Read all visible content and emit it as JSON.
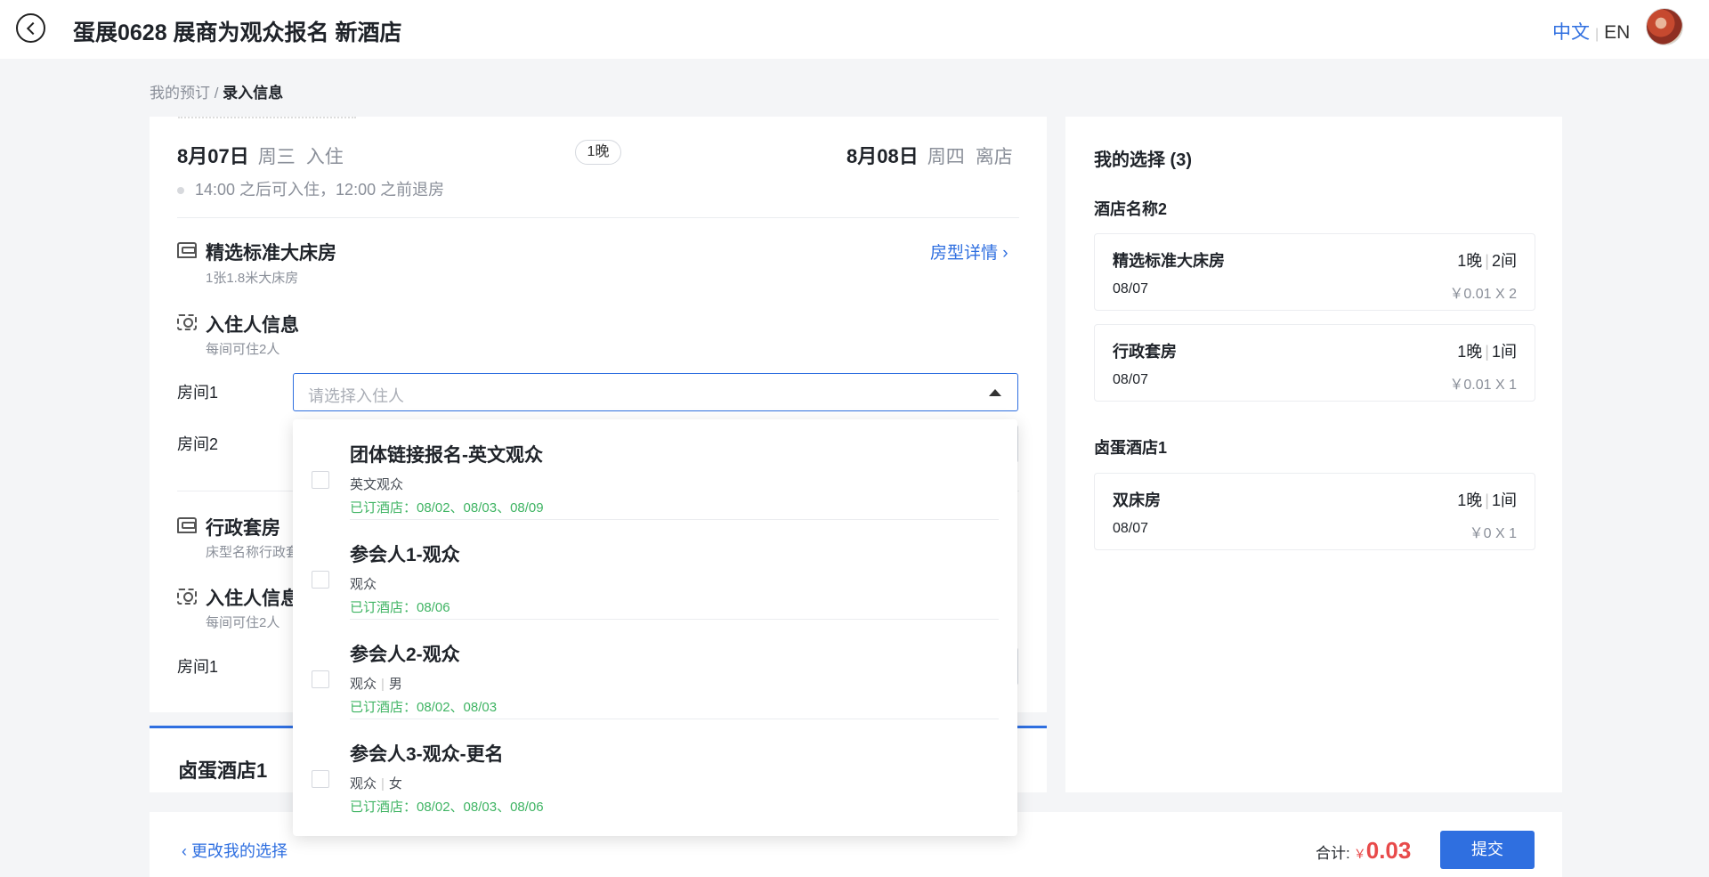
{
  "header": {
    "title": "蛋展0628 展商为观众报名 新酒店",
    "lang_zh": "中文",
    "lang_en": "EN"
  },
  "breadcrumb": {
    "parent": "我的预订",
    "separator": " / ",
    "current": "录入信息"
  },
  "stay": {
    "checkin_date": "8月07日",
    "checkin_weekday": "周三",
    "checkin_label": "入住",
    "nights": "1晚",
    "checkout_date": "8月08日",
    "checkout_weekday": "周四",
    "checkout_label": "离店",
    "tip": "14:00 之后可入住，12:00 之前退房"
  },
  "room_types": [
    {
      "name": "精选标准大床房",
      "bed": "1张1.8米大床房",
      "detail_link": "房型详情",
      "guest_section": "入住人信息",
      "guest_note": "每间可住2人",
      "rooms": [
        "房间1",
        "房间2"
      ],
      "select_placeholder": "请选择入住人"
    },
    {
      "name": "行政套房",
      "bed": "床型名称行政套",
      "guest_section": "入住人信息",
      "guest_note": "每间可住2人",
      "rooms": [
        "房间1"
      ]
    }
  ],
  "next_hotel_tab": "卤蛋酒店1",
  "dropdown": {
    "options": [
      {
        "name": "团体链接报名-英文观众",
        "role": "英文观众",
        "gender": "",
        "booked": "已订酒店：08/02、08/03、08/09"
      },
      {
        "name": "参会人1-观众",
        "role": "观众",
        "gender": "",
        "booked": "已订酒店：08/06"
      },
      {
        "name": "参会人2-观众",
        "role": "观众",
        "gender": "男",
        "booked": "已订酒店：08/02、08/03"
      },
      {
        "name": "参会人3-观众-更名",
        "role": "观众",
        "gender": "女",
        "booked": "已订酒店：08/02、08/03、08/06"
      }
    ]
  },
  "my_selection": {
    "title": "我的选择 (3)",
    "hotels": [
      {
        "name": "酒店名称2",
        "items": [
          {
            "room": "精选标准大床房",
            "nights": "1晚",
            "count": "2间",
            "date": "08/07",
            "price": "￥0.01 X 2"
          },
          {
            "room": "行政套房",
            "nights": "1晚",
            "count": "1间",
            "date": "08/07",
            "price": "￥0.01 X 1"
          }
        ]
      },
      {
        "name": "卤蛋酒店1",
        "items": [
          {
            "room": "双床房",
            "nights": "1晚",
            "count": "1间",
            "date": "08/07",
            "price": "￥0 X 1"
          }
        ]
      }
    ]
  },
  "footer": {
    "change_link": "更改我的选择",
    "total_label": "合计:",
    "currency": "￥",
    "total_amount": "0.03",
    "submit": "提交"
  },
  "colors": {
    "accent": "#2f6fe0",
    "price": "#e84a4a",
    "booked_green": "#3fb463"
  }
}
